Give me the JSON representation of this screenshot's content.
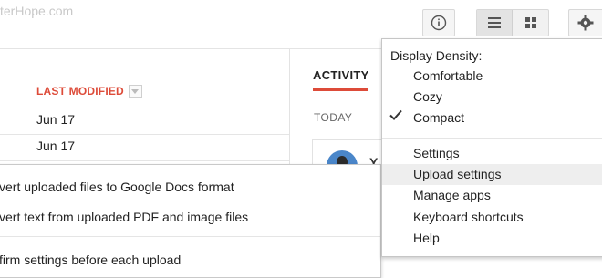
{
  "header": {
    "watermark": "terHope.com"
  },
  "file_list": {
    "column_header": "LAST MODIFIED",
    "rows": [
      {
        "modified": "Jun 17"
      },
      {
        "modified": "Jun 17"
      }
    ]
  },
  "activity": {
    "tab_label": "ACTIVITY",
    "section_label": "TODAY",
    "card_initial": "Y"
  },
  "upload_submenu": {
    "items": [
      "vert uploaded files to Google Docs format",
      "vert text from uploaded PDF and image files",
      "firm settings before each upload"
    ]
  },
  "settings_menu": {
    "density_heading": "Display Density:",
    "density_options": [
      {
        "label": "Comfortable",
        "checked": false
      },
      {
        "label": "Cozy",
        "checked": false
      },
      {
        "label": "Compact",
        "checked": true
      }
    ],
    "items": [
      {
        "label": "Settings",
        "highlighted": false
      },
      {
        "label": "Upload settings",
        "highlighted": true
      },
      {
        "label": "Manage apps",
        "highlighted": false
      },
      {
        "label": "Keyboard shortcuts",
        "highlighted": false
      },
      {
        "label": "Help",
        "highlighted": false
      }
    ]
  },
  "colors": {
    "accent_red": "#dd4b39",
    "menu_highlight": "#eeeeee"
  }
}
